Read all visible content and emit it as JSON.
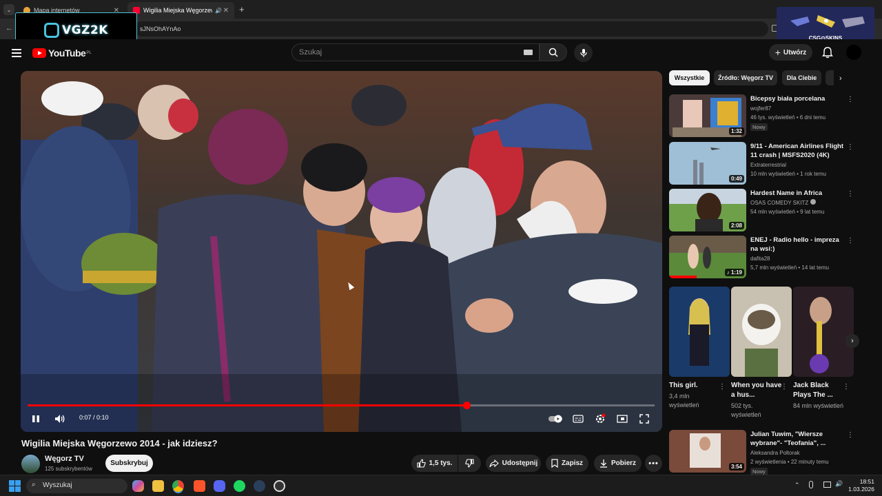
{
  "browser": {
    "tabs": [
      {
        "label": "Mapa internetów"
      },
      {
        "label": "Wigilia Miejska Węgorzewo"
      }
    ],
    "url": "sJNsOhAYnAo",
    "overlay_logo": "VGZ2K",
    "overlay_csgo": "CSG⊙SKINS"
  },
  "header": {
    "logo": "YouTube",
    "logo_region": "PL",
    "search_placeholder": "Szukaj",
    "create_label": "Utwórz"
  },
  "player": {
    "time": "0:07 / 0:10",
    "progress": 0.7
  },
  "video": {
    "title": "Wigilia Miejska Węgorzewo 2014 - jak idziesz?",
    "channel": "Węgorz TV",
    "subscribers": "125 subskrybentów",
    "subscribe_label": "Subskrybuj",
    "likes": "1,5 tys.",
    "share_label": "Udostępnij",
    "save_label": "Zapisz",
    "download_label": "Pobierz"
  },
  "sidebar": {
    "chips": [
      "Wszystkie",
      "Źródło: Węgorz TV",
      "Dla Ciebie"
    ],
    "recs": [
      {
        "title": "Bicepsy biała porcelana",
        "channel": "wojfer87",
        "stats": "46 tys. wyświetleń • 6 dni temu",
        "badge": "Nowy",
        "duration": "1:32"
      },
      {
        "title": "9/11 - American Airlines Flight 11 crash | MSFS2020 (4K)",
        "channel": "Extraterrestrial",
        "stats": "10 mln wyświetleń • 1 rok temu",
        "duration": "0:49"
      },
      {
        "title": "Hardest Name in Africa",
        "channel": "OSAS COMEDY SKITZ",
        "stats": "54 mln wyświetleń • 9 lat temu",
        "duration": "2:08"
      },
      {
        "title": "ENEJ - Radio hello - impreza na wsi:)",
        "channel": "dafita28",
        "stats": "5,7 mln wyświetleń • 14 lat temu",
        "duration": "1:19"
      },
      {
        "title": "Julian Tuwim, \"Wiersze wybrane\"- \"Teofania\", ...",
        "channel": "Aleksandra Poltorak",
        "stats": "2 wyświetlenia • 22 minuty temu",
        "badge": "Nowy",
        "duration": "3:54"
      }
    ],
    "shorts": [
      {
        "title": "This girl.",
        "views": "3,4 mln wyświetleń"
      },
      {
        "title": "When you have a hus...",
        "views": "502 tys. wyświetleń"
      },
      {
        "title": "Jack Black Plays The ...",
        "views": "84 mln wyświetleń"
      }
    ]
  },
  "taskbar": {
    "search_label": "Wyszukaj",
    "time": "18:51",
    "date": "1.03.2026"
  },
  "colors": {
    "accent": "#ff0000",
    "background": "#0f0f0f"
  }
}
